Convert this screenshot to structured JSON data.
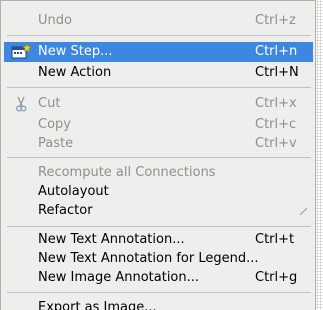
{
  "menu": {
    "items": [
      {
        "label": "Undo",
        "shortcut": "Ctrl+z",
        "enabled": false
      },
      {
        "label": "New Step...",
        "shortcut": "Ctrl+n",
        "enabled": true,
        "highlighted": true,
        "icon": "new-step-icon"
      },
      {
        "label": "New Action",
        "shortcut": "Ctrl+N",
        "enabled": true
      },
      {
        "label": "Cut",
        "shortcut": "Ctrl+x",
        "enabled": false,
        "icon": "scissors-icon"
      },
      {
        "label": "Copy",
        "shortcut": "Ctrl+c",
        "enabled": false
      },
      {
        "label": "Paste",
        "shortcut": "Ctrl+v",
        "enabled": false
      },
      {
        "label": "Recompute all Connections",
        "shortcut": "",
        "enabled": false
      },
      {
        "label": "Autolayout",
        "shortcut": "",
        "enabled": true
      },
      {
        "label": "Refactor",
        "shortcut": "",
        "enabled": true,
        "has_submenu": true
      },
      {
        "label": "New Text Annotation...",
        "shortcut": "Ctrl+t",
        "enabled": true
      },
      {
        "label": "New Text Annotation for Legend...",
        "shortcut": "",
        "enabled": true
      },
      {
        "label": "New Image Annotation...",
        "shortcut": "Ctrl+g",
        "enabled": true
      },
      {
        "label": "Export as Image...",
        "shortcut": "",
        "enabled": true
      }
    ]
  },
  "colors": {
    "highlight": "#3d87e0",
    "disabled_text": "#8f8f8b",
    "menu_bg": "#eeeeec"
  }
}
